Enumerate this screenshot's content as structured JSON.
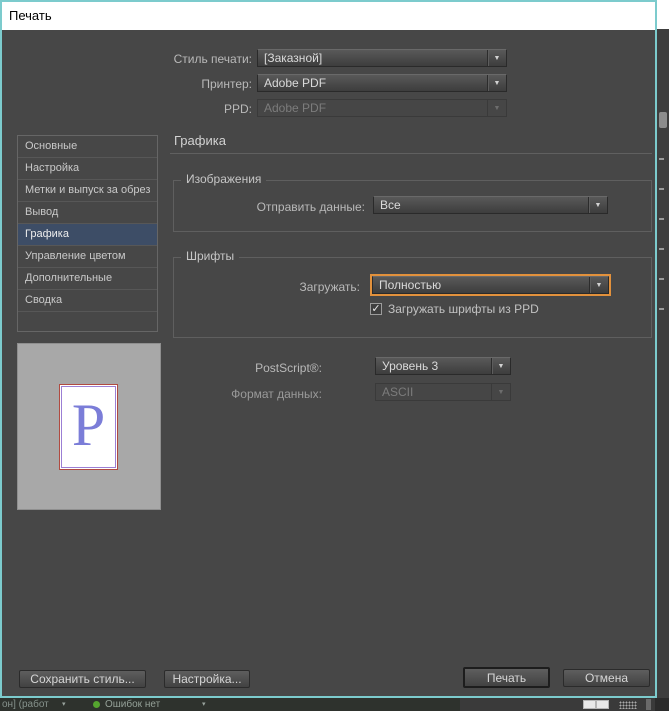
{
  "window": {
    "title": "Печать"
  },
  "top_form": {
    "rows": [
      {
        "label": "Стиль печати:",
        "value": "[Заказной]"
      },
      {
        "label": "Принтер:",
        "value": "Adobe PDF"
      },
      {
        "label": "PPD:",
        "value": "Adobe PDF"
      }
    ]
  },
  "sidebar": {
    "selected_index": 4,
    "items": [
      {
        "label": "Основные"
      },
      {
        "label": "Настройка"
      },
      {
        "label": "Метки и выпуск за обрез"
      },
      {
        "label": "Вывод"
      },
      {
        "label": "Графика"
      },
      {
        "label": "Управление цветом"
      },
      {
        "label": "Дополнительные"
      },
      {
        "label": "Сводка"
      }
    ]
  },
  "preview": {
    "page_letter": "P"
  },
  "panel": {
    "heading": "Графика",
    "images_group": {
      "legend": "Изображения",
      "send_data_label": "Отправить данные:",
      "send_data_value": "Все"
    },
    "fonts_group": {
      "legend": "Шрифты",
      "download_label": "Загружать:",
      "download_value": "Полностью",
      "ppd_checkbox_checked": true,
      "ppd_checkbox_label": "Загружать шрифты из PPD"
    },
    "postscript_label": "PostScript®:",
    "postscript_value": "Уровень 3",
    "data_format_label": "Формат данных:",
    "data_format_value": "ASCII"
  },
  "footer": {
    "save_style_button": "Сохранить стиль...",
    "setup_button": "Настройка...",
    "print_button": "Печать",
    "cancel_button": "Отмена"
  },
  "background_statusbar": {
    "left_fragment": "он] (работ",
    "no_errors_text": "Ошибок нет"
  },
  "icons": {
    "dropdown_arrow": "▼",
    "status_caret": "▾",
    "check_glyph": "✓"
  },
  "colors": {
    "dialog_border": "#7ccbcd",
    "focus_accent": "#e2913c",
    "selected_item_bg": "#3d4d66",
    "status_ok_dot": "#55a52f",
    "preview_letter": "#7b7dd8",
    "page_border_outer": "#b04a40",
    "page_border_inner": "#9b7fd4"
  }
}
